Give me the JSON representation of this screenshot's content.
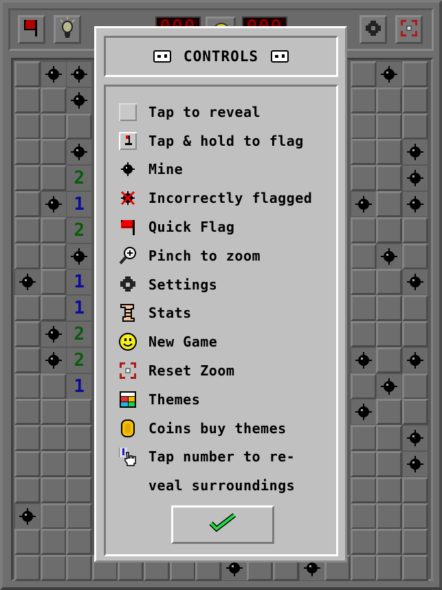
{
  "topbar": {
    "quick_flag_button": "quick-flag",
    "hint_button": "hint",
    "mine_counter": "000",
    "timer": "000",
    "new_game_button": "smiley-face",
    "settings_button": "settings",
    "reset_zoom_button": "reset-zoom"
  },
  "colors": {
    "one": "#0b0b9a",
    "two": "#0b5a0b",
    "flag_red": "#d00000",
    "check_green": "#22dd44"
  },
  "board": {
    "columns": 16,
    "rows": 20,
    "visible_cells": [
      {
        "r": 0,
        "c": 0,
        "s": "closed"
      },
      {
        "r": 0,
        "c": 1,
        "s": "mine"
      },
      {
        "r": 0,
        "c": 2,
        "s": "mine"
      },
      {
        "r": 0,
        "c": 13,
        "s": "closed"
      },
      {
        "r": 0,
        "c": 14,
        "s": "mine"
      },
      {
        "r": 0,
        "c": 15,
        "s": "closed"
      },
      {
        "r": 1,
        "c": 0,
        "s": "closed"
      },
      {
        "r": 1,
        "c": 1,
        "s": "closed"
      },
      {
        "r": 1,
        "c": 2,
        "s": "mine"
      },
      {
        "r": 1,
        "c": 13,
        "s": "closed"
      },
      {
        "r": 1,
        "c": 14,
        "s": "closed"
      },
      {
        "r": 1,
        "c": 15,
        "s": "closed"
      },
      {
        "r": 2,
        "c": 0,
        "s": "closed"
      },
      {
        "r": 2,
        "c": 1,
        "s": "closed"
      },
      {
        "r": 2,
        "c": 2,
        "s": "closed"
      },
      {
        "r": 2,
        "c": 13,
        "s": "closed"
      },
      {
        "r": 2,
        "c": 14,
        "s": "closed"
      },
      {
        "r": 2,
        "c": 15,
        "s": "closed"
      },
      {
        "r": 3,
        "c": 0,
        "s": "closed"
      },
      {
        "r": 3,
        "c": 1,
        "s": "closed"
      },
      {
        "r": 3,
        "c": 2,
        "s": "mine"
      },
      {
        "r": 3,
        "c": 13,
        "s": "closed"
      },
      {
        "r": 3,
        "c": 14,
        "s": "closed"
      },
      {
        "r": 3,
        "c": 15,
        "s": "mine"
      },
      {
        "r": 4,
        "c": 0,
        "s": "closed"
      },
      {
        "r": 4,
        "c": 1,
        "s": "closed"
      },
      {
        "r": 4,
        "c": 2,
        "s": "2"
      },
      {
        "r": 4,
        "c": 13,
        "s": "closed"
      },
      {
        "r": 4,
        "c": 14,
        "s": "closed"
      },
      {
        "r": 4,
        "c": 15,
        "s": "mine"
      },
      {
        "r": 5,
        "c": 0,
        "s": "closed"
      },
      {
        "r": 5,
        "c": 1,
        "s": "mine"
      },
      {
        "r": 5,
        "c": 2,
        "s": "1"
      },
      {
        "r": 5,
        "c": 13,
        "s": "mine"
      },
      {
        "r": 5,
        "c": 14,
        "s": "closed"
      },
      {
        "r": 5,
        "c": 15,
        "s": "mine"
      },
      {
        "r": 6,
        "c": 0,
        "s": "closed"
      },
      {
        "r": 6,
        "c": 1,
        "s": "closed"
      },
      {
        "r": 6,
        "c": 2,
        "s": "2"
      },
      {
        "r": 6,
        "c": 13,
        "s": "closed"
      },
      {
        "r": 6,
        "c": 14,
        "s": "closed"
      },
      {
        "r": 6,
        "c": 15,
        "s": "closed"
      },
      {
        "r": 7,
        "c": 0,
        "s": "closed"
      },
      {
        "r": 7,
        "c": 1,
        "s": "closed"
      },
      {
        "r": 7,
        "c": 2,
        "s": "mine"
      },
      {
        "r": 7,
        "c": 13,
        "s": "closed"
      },
      {
        "r": 7,
        "c": 14,
        "s": "mine"
      },
      {
        "r": 7,
        "c": 15,
        "s": "closed"
      },
      {
        "r": 8,
        "c": 0,
        "s": "mine"
      },
      {
        "r": 8,
        "c": 1,
        "s": "closed"
      },
      {
        "r": 8,
        "c": 2,
        "s": "1"
      },
      {
        "r": 8,
        "c": 13,
        "s": "closed"
      },
      {
        "r": 8,
        "c": 14,
        "s": "closed"
      },
      {
        "r": 8,
        "c": 15,
        "s": "mine"
      },
      {
        "r": 9,
        "c": 0,
        "s": "closed"
      },
      {
        "r": 9,
        "c": 1,
        "s": "closed"
      },
      {
        "r": 9,
        "c": 2,
        "s": "1"
      },
      {
        "r": 9,
        "c": 13,
        "s": "closed"
      },
      {
        "r": 9,
        "c": 14,
        "s": "closed"
      },
      {
        "r": 9,
        "c": 15,
        "s": "closed"
      },
      {
        "r": 10,
        "c": 0,
        "s": "closed"
      },
      {
        "r": 10,
        "c": 1,
        "s": "mine"
      },
      {
        "r": 10,
        "c": 2,
        "s": "2"
      },
      {
        "r": 10,
        "c": 13,
        "s": "closed"
      },
      {
        "r": 10,
        "c": 14,
        "s": "closed"
      },
      {
        "r": 10,
        "c": 15,
        "s": "closed"
      },
      {
        "r": 11,
        "c": 0,
        "s": "closed"
      },
      {
        "r": 11,
        "c": 1,
        "s": "mine"
      },
      {
        "r": 11,
        "c": 2,
        "s": "2"
      },
      {
        "r": 11,
        "c": 13,
        "s": "mine"
      },
      {
        "r": 11,
        "c": 14,
        "s": "closed"
      },
      {
        "r": 11,
        "c": 15,
        "s": "mine"
      },
      {
        "r": 12,
        "c": 0,
        "s": "closed"
      },
      {
        "r": 12,
        "c": 1,
        "s": "closed"
      },
      {
        "r": 12,
        "c": 2,
        "s": "1"
      },
      {
        "r": 12,
        "c": 13,
        "s": "closed"
      },
      {
        "r": 12,
        "c": 14,
        "s": "mine"
      },
      {
        "r": 12,
        "c": 15,
        "s": "closed"
      },
      {
        "r": 13,
        "c": 0,
        "s": "closed"
      },
      {
        "r": 13,
        "c": 1,
        "s": "closed"
      },
      {
        "r": 13,
        "c": 2,
        "s": "closed"
      },
      {
        "r": 13,
        "c": 13,
        "s": "mine"
      },
      {
        "r": 13,
        "c": 14,
        "s": "closed"
      },
      {
        "r": 13,
        "c": 15,
        "s": "closed"
      },
      {
        "r": 14,
        "c": 0,
        "s": "closed"
      },
      {
        "r": 14,
        "c": 1,
        "s": "closed"
      },
      {
        "r": 14,
        "c": 2,
        "s": "closed"
      },
      {
        "r": 14,
        "c": 13,
        "s": "closed"
      },
      {
        "r": 14,
        "c": 14,
        "s": "closed"
      },
      {
        "r": 14,
        "c": 15,
        "s": "mine"
      },
      {
        "r": 15,
        "c": 0,
        "s": "closed"
      },
      {
        "r": 15,
        "c": 1,
        "s": "closed"
      },
      {
        "r": 15,
        "c": 2,
        "s": "closed"
      },
      {
        "r": 15,
        "c": 13,
        "s": "closed"
      },
      {
        "r": 15,
        "c": 14,
        "s": "closed"
      },
      {
        "r": 15,
        "c": 15,
        "s": "mine"
      },
      {
        "r": 16,
        "c": 0,
        "s": "closed"
      },
      {
        "r": 16,
        "c": 1,
        "s": "closed"
      },
      {
        "r": 16,
        "c": 2,
        "s": "closed"
      },
      {
        "r": 16,
        "c": 13,
        "s": "closed"
      },
      {
        "r": 16,
        "c": 14,
        "s": "closed"
      },
      {
        "r": 16,
        "c": 15,
        "s": "closed"
      },
      {
        "r": 17,
        "c": 0,
        "s": "mine"
      },
      {
        "r": 17,
        "c": 1,
        "s": "closed"
      },
      {
        "r": 17,
        "c": 2,
        "s": "closed"
      },
      {
        "r": 17,
        "c": 13,
        "s": "closed"
      },
      {
        "r": 17,
        "c": 14,
        "s": "closed"
      },
      {
        "r": 17,
        "c": 15,
        "s": "closed"
      },
      {
        "r": 18,
        "c": 0,
        "s": "closed"
      },
      {
        "r": 18,
        "c": 1,
        "s": "closed"
      },
      {
        "r": 18,
        "c": 2,
        "s": "closed"
      },
      {
        "r": 18,
        "c": 13,
        "s": "closed"
      },
      {
        "r": 18,
        "c": 14,
        "s": "closed"
      },
      {
        "r": 18,
        "c": 15,
        "s": "closed"
      },
      {
        "r": 19,
        "c": 0,
        "s": "closed"
      },
      {
        "r": 19,
        "c": 1,
        "s": "closed"
      },
      {
        "r": 19,
        "c": 2,
        "s": "closed"
      },
      {
        "r": 19,
        "c": 3,
        "s": "closed"
      },
      {
        "r": 19,
        "c": 4,
        "s": "closed"
      },
      {
        "r": 19,
        "c": 5,
        "s": "closed"
      },
      {
        "r": 19,
        "c": 6,
        "s": "closed"
      },
      {
        "r": 19,
        "c": 7,
        "s": "closed"
      },
      {
        "r": 19,
        "c": 8,
        "s": "mine"
      },
      {
        "r": 19,
        "c": 9,
        "s": "closed"
      },
      {
        "r": 19,
        "c": 10,
        "s": "closed"
      },
      {
        "r": 19,
        "c": 11,
        "s": "mine"
      },
      {
        "r": 19,
        "c": 12,
        "s": "closed"
      },
      {
        "r": 19,
        "c": 13,
        "s": "closed"
      },
      {
        "r": 19,
        "c": 14,
        "s": "closed"
      },
      {
        "r": 19,
        "c": 15,
        "s": "closed"
      }
    ]
  },
  "modal": {
    "title": "CONTROLS",
    "title_icon": "gamepad-icon",
    "items": [
      {
        "icon": "closed-cell-icon",
        "label": "Tap to reveal"
      },
      {
        "icon": "flagged-cell-icon",
        "label": "Tap & hold to flag"
      },
      {
        "icon": "mine-icon",
        "label": "Mine"
      },
      {
        "icon": "incorrect-flag-icon",
        "label": "Incorrectly flagged"
      },
      {
        "icon": "quick-flag-icon",
        "label": "Quick Flag"
      },
      {
        "icon": "magnifier-icon",
        "label": "Pinch to zoom"
      },
      {
        "icon": "gear-icon",
        "label": "Settings"
      },
      {
        "icon": "scroll-icon",
        "label": "Stats"
      },
      {
        "icon": "smiley-icon",
        "label": "New Game"
      },
      {
        "icon": "reset-zoom-icon",
        "label": "Reset Zoom"
      },
      {
        "icon": "themes-icon",
        "label": "Themes"
      },
      {
        "icon": "coin-icon",
        "label": "Coins buy themes"
      },
      {
        "icon": "tap-number-icon",
        "label": "Tap number to re-"
      },
      {
        "icon": "",
        "label": "veal surroundings"
      }
    ],
    "ok_button": "check-icon"
  }
}
